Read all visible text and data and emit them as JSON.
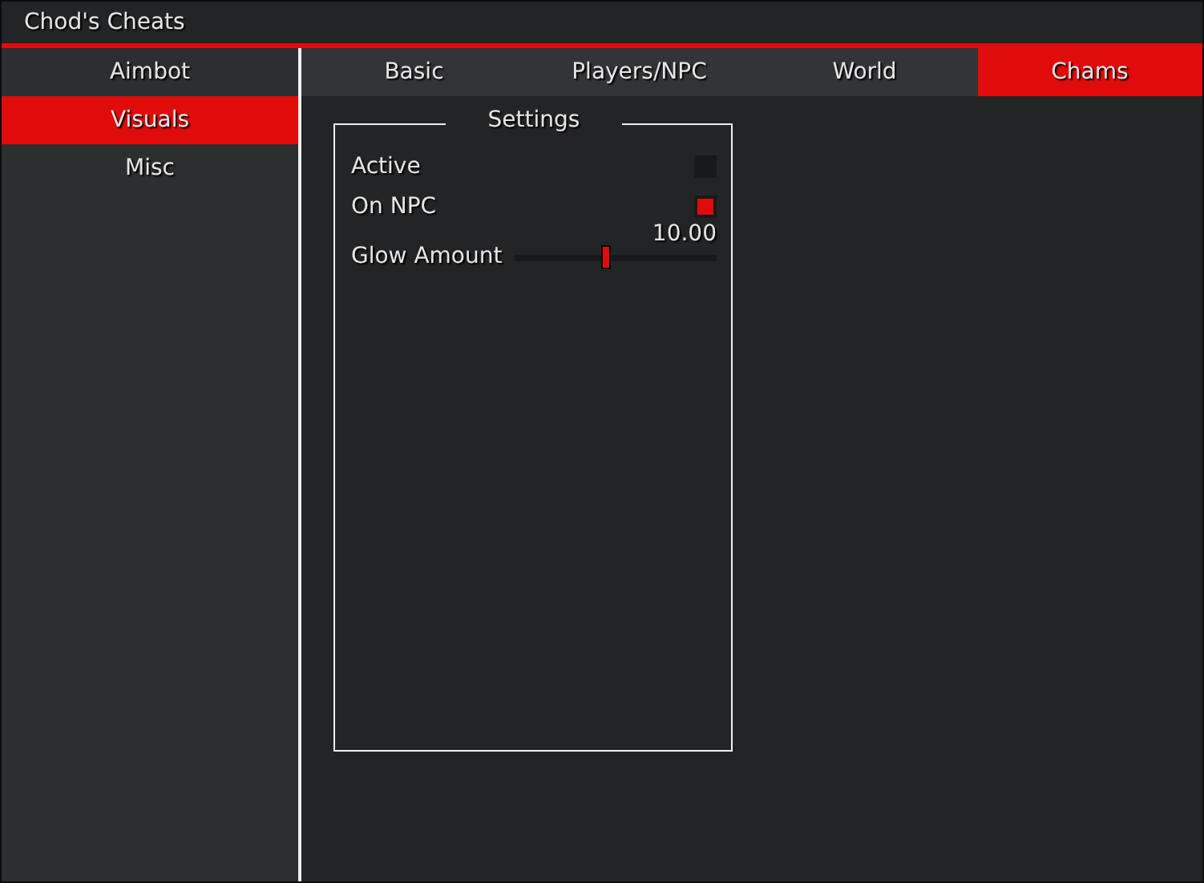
{
  "window": {
    "title": "Chod's Cheats"
  },
  "sidebar": {
    "items": [
      {
        "label": "Aimbot",
        "selected": false
      },
      {
        "label": "Visuals",
        "selected": true
      },
      {
        "label": "Misc",
        "selected": false
      }
    ]
  },
  "tabs": [
    {
      "label": "Basic",
      "selected": false
    },
    {
      "label": "Players/NPC",
      "selected": false
    },
    {
      "label": "World",
      "selected": false
    },
    {
      "label": "Chams",
      "selected": true
    }
  ],
  "group": {
    "title": "Settings",
    "rows": [
      {
        "kind": "checkbox",
        "label": "Active",
        "checked": false
      },
      {
        "kind": "checkbox",
        "label": "On NPC",
        "checked": true
      },
      {
        "kind": "slider",
        "label": "Glow Amount",
        "level": 0.45,
        "reading": "10.00"
      }
    ]
  }
}
